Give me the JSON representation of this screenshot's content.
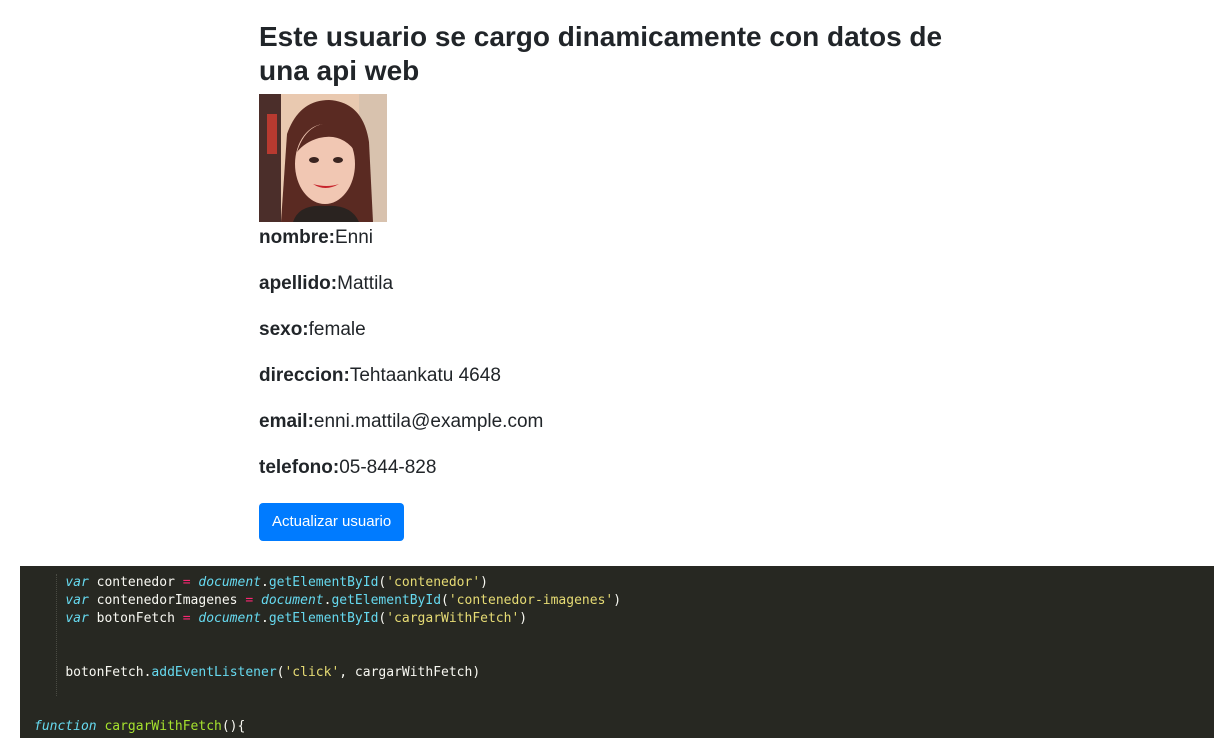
{
  "header": {
    "title": "Este usuario se cargo dinamicamente con datos de una api web"
  },
  "user": {
    "photo_alt": "user photo",
    "fields": [
      {
        "key": "nombre:",
        "value": "Enni"
      },
      {
        "key": "apellido:",
        "value": "Mattila"
      },
      {
        "key": "sexo:",
        "value": "female"
      },
      {
        "key": "direccion:",
        "value": "Tehtaankatu 4648"
      },
      {
        "key": "email:",
        "value": "enni.mattila@example.com"
      },
      {
        "key": "telefono:",
        "value": "05-844-828"
      }
    ]
  },
  "actions": {
    "update_label": "Actualizar usuario"
  },
  "code": {
    "line1": {
      "kw": "var",
      "name": " contenedor ",
      "op": "=",
      "sp": " ",
      "obj": "document",
      "dot": ".",
      "fn": "getElementById",
      "open": "(",
      "str": "'contenedor'",
      "close": ")"
    },
    "line2": {
      "kw": "var",
      "name": " contenedorImagenes ",
      "op": "=",
      "sp": " ",
      "obj": "document",
      "dot": ".",
      "fn": "getElementById",
      "open": "(",
      "str": "'contenedor-imagenes'",
      "close": ")"
    },
    "line3": {
      "kw": "var",
      "name": " botonFetch ",
      "op": "=",
      "sp": " ",
      "obj": "document",
      "dot": ".",
      "fn": "getElementById",
      "open": "(",
      "str": "'cargarWithFetch'",
      "close": ")"
    },
    "line4": {
      "obj": "botonFetch",
      "dot": ".",
      "fn": "addEventListener",
      "open": "(",
      "str": "'click'",
      "rest": ", cargarWithFetch)"
    },
    "line5": {
      "kw": "function",
      "sp": " ",
      "name": "cargarWithFetch",
      "rest": "(){"
    }
  },
  "colors": {
    "button_bg": "#007bff",
    "code_bg": "#272822",
    "keyword": "#66d9ef",
    "string": "#e6db74",
    "operator": "#f92672",
    "function_name": "#a6e22e"
  }
}
